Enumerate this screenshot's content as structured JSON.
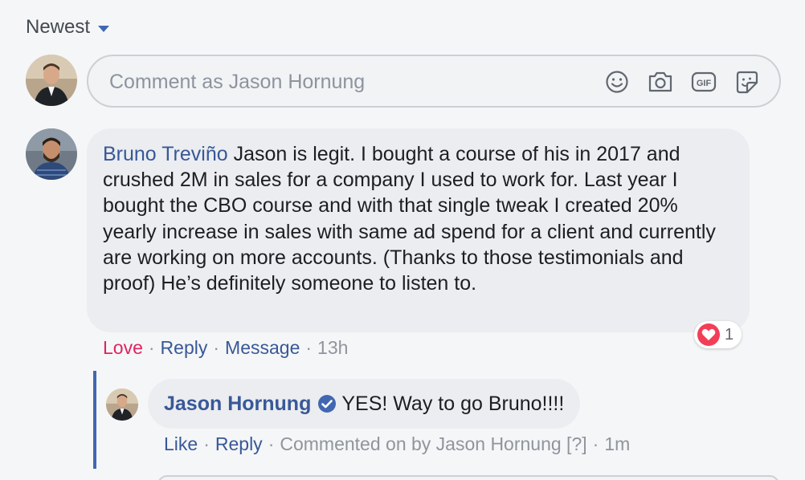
{
  "sort": {
    "label": "Newest"
  },
  "composer": {
    "placeholder": "Comment as Jason Hornung",
    "tools": [
      "emoji-icon",
      "camera-icon",
      "gif-icon",
      "sticker-icon"
    ]
  },
  "comment": {
    "author": "Bruno Treviño",
    "text": " Jason is legit. I bought a course of his in 2017 and crushed 2M in sales for a company I used to work for. Last year I bought the CBO course and with that single tweak I created 20% yearly increase in sales with same ad spend for a client and currently are working on more accounts. (Thanks to those testimonials and proof) He’s definitely someone to listen to.",
    "reaction_count": "1",
    "reaction_icon": "heart-icon",
    "actions": {
      "love": "Love",
      "reply": "Reply",
      "message": "Message",
      "time": "13h",
      "separator": "·"
    }
  },
  "reply": {
    "author": "Jason Hornung",
    "verified_icon": "verified-badge-icon",
    "text": "YES! Way to go Bruno!!!!",
    "actions": {
      "like": "Like",
      "reply": "Reply",
      "meta": "Commented on by Jason Hornung [?]",
      "time": "1m",
      "separator": "·"
    }
  },
  "colors": {
    "link": "#385898",
    "accent": "#4267b2",
    "love": "#e0245e",
    "heart": "#f33e58",
    "bubble": "#ebedf0",
    "background": "#f5f6f7"
  }
}
